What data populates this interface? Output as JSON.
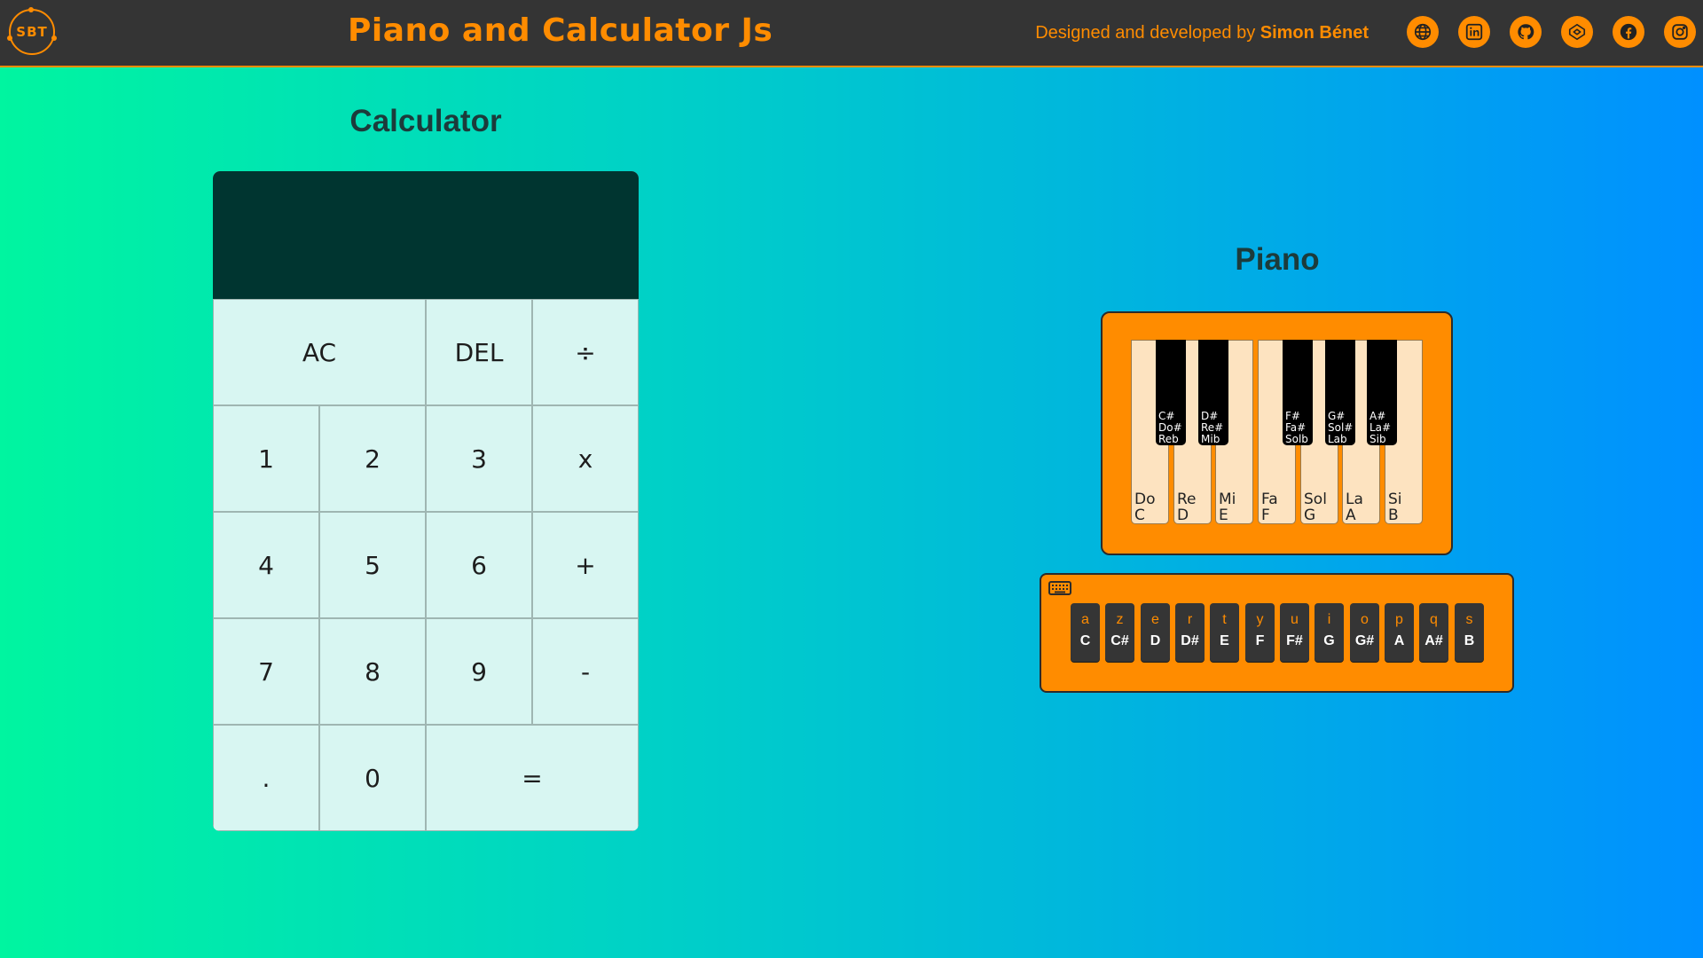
{
  "header": {
    "logo_text": "SBT",
    "title": "Piano and Calculator Js",
    "credit_prefix": "Designed and developed by",
    "credit_name": "Simon Bénet",
    "socials": [
      {
        "icon": "globe-icon"
      },
      {
        "icon": "linkedin-icon"
      },
      {
        "icon": "github-icon"
      },
      {
        "icon": "codepen-icon"
      },
      {
        "icon": "facebook-icon"
      },
      {
        "icon": "instagram-icon"
      }
    ]
  },
  "calculator": {
    "title": "Calculator",
    "display": "",
    "buttons": {
      "ac": "AC",
      "del": "DEL",
      "divide": "÷",
      "one": "1",
      "two": "2",
      "three": "3",
      "multiply": "x",
      "four": "4",
      "five": "5",
      "six": "6",
      "plus": "+",
      "seven": "7",
      "eight": "8",
      "nine": "9",
      "minus": "-",
      "dot": ".",
      "zero": "0",
      "equals": "="
    }
  },
  "piano": {
    "title": "Piano",
    "white_keys": [
      {
        "l1": "Do",
        "l2": "C"
      },
      {
        "l1": "Re",
        "l2": "D"
      },
      {
        "l1": "Mi",
        "l2": "E"
      },
      {
        "l1": "Fa",
        "l2": "F"
      },
      {
        "l1": "Sol",
        "l2": "G"
      },
      {
        "l1": "La",
        "l2": "A"
      },
      {
        "l1": "Si",
        "l2": "B"
      }
    ],
    "black_keys": [
      {
        "l1": "C#",
        "l2": "Do#",
        "l3": "Reb"
      },
      {
        "l1": "D#",
        "l2": "Re#",
        "l3": "Mib"
      },
      {
        "l1": "F#",
        "l2": "Fa#",
        "l3": "Solb"
      },
      {
        "l1": "G#",
        "l2": "Sol#",
        "l3": "Lab"
      },
      {
        "l1": "A#",
        "l2": "La#",
        "l3": "Sib"
      }
    ]
  },
  "keyboard_map": {
    "icon": "keyboard-icon",
    "keys": [
      {
        "key": "a",
        "note": "C"
      },
      {
        "key": "z",
        "note": "C#"
      },
      {
        "key": "e",
        "note": "D"
      },
      {
        "key": "r",
        "note": "D#"
      },
      {
        "key": "t",
        "note": "E"
      },
      {
        "key": "y",
        "note": "F"
      },
      {
        "key": "u",
        "note": "F#"
      },
      {
        "key": "i",
        "note": "G"
      },
      {
        "key": "o",
        "note": "G#"
      },
      {
        "key": "p",
        "note": "A"
      },
      {
        "key": "q",
        "note": "A#"
      },
      {
        "key": "s",
        "note": "B"
      }
    ]
  },
  "colors": {
    "accent": "#ff8c00",
    "header_bg": "#343434",
    "display_bg": "#003530",
    "button_bg": "#d8f6f2",
    "white_key": "#fde3c0"
  }
}
